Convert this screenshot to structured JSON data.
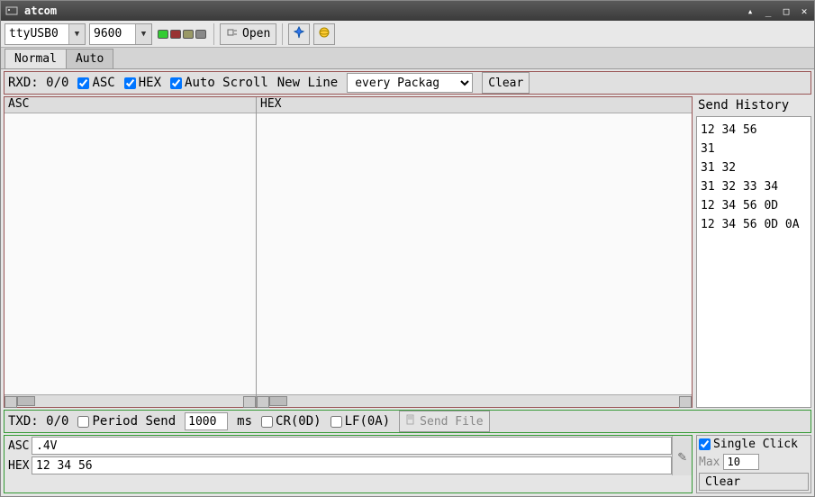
{
  "window": {
    "title": "atcom"
  },
  "toolbar": {
    "port_value": "ttyUSB0",
    "baud_value": "9600",
    "open_label": "Open"
  },
  "tabs": {
    "normal": "Normal",
    "auto": "Auto"
  },
  "rx": {
    "label": "RXD: 0/0",
    "asc": "ASC",
    "hex": "HEX",
    "autoscroll": "Auto Scroll",
    "newline": "New Line",
    "newline_opt": "every Package",
    "clear": "Clear"
  },
  "panes": {
    "asc_hdr": "ASC",
    "hex_hdr": "HEX"
  },
  "history": {
    "header": "Send History",
    "items": [
      "12 34 56",
      "31",
      "31 32",
      "31 32 33 34",
      "12 34 56 0D",
      "12 34 56 0D 0A"
    ]
  },
  "tx": {
    "label": "TXD: 0/0",
    "period": "Period Send",
    "period_val": "1000",
    "ms": "ms",
    "cr": "CR(0D)",
    "lf": "LF(0A)",
    "sendfile": "Send File"
  },
  "input": {
    "asc_label": "ASC",
    "asc_value": ".4V",
    "hex_label": "HEX",
    "hex_value": "12 34 56"
  },
  "right": {
    "single": "Single Click",
    "max": "Max",
    "max_val": "10",
    "clear": "Clear"
  }
}
